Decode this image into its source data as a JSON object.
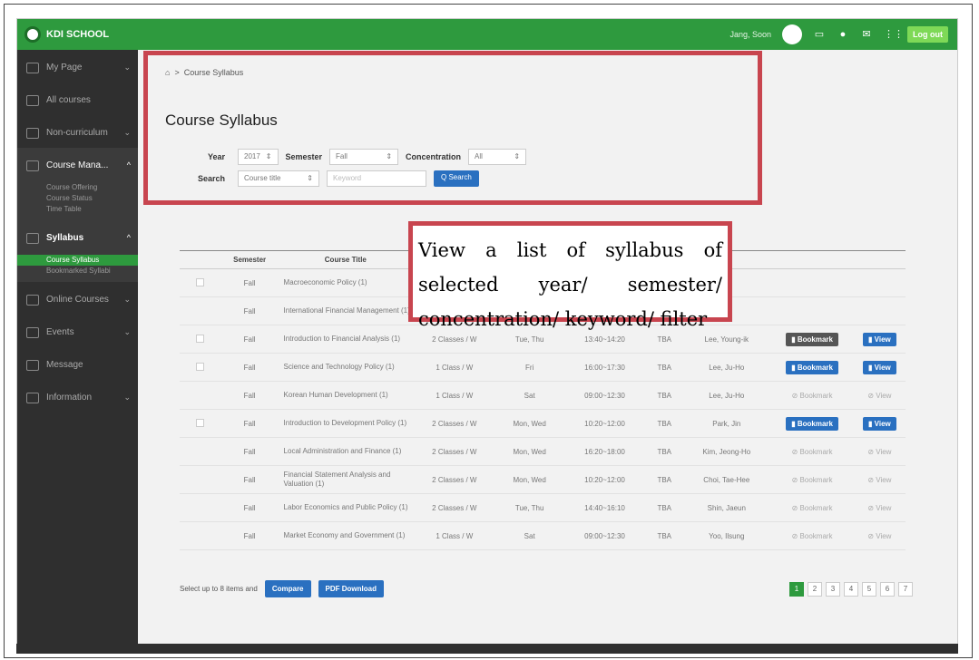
{
  "topbar": {
    "logo_text": "KDI SCHOOL",
    "user_name": "Jang, Soon",
    "logout_label": "Log out",
    "icons": [
      "monitor-icon",
      "bell-icon",
      "mail-icon",
      "grid-icon"
    ]
  },
  "sidebar": {
    "items": [
      {
        "label": "My Page",
        "chevron": "⌄"
      },
      {
        "label": "All courses",
        "chevron": ""
      },
      {
        "label": "Non-curriculum",
        "chevron": "⌄"
      },
      {
        "label": "Course Mana...",
        "chevron": "^"
      },
      {
        "label": "Syllabus",
        "chevron": "^"
      },
      {
        "label": "Online Courses",
        "chevron": "⌄"
      },
      {
        "label": "Events",
        "chevron": "⌄"
      },
      {
        "label": "Message",
        "chevron": ""
      },
      {
        "label": "Information",
        "chevron": "⌄"
      }
    ],
    "course_sub": [
      "Course Offering",
      "Course Status",
      "Time Table"
    ],
    "syllabus_sub": [
      "Course Syllabus",
      "Bookmarked Syllabi"
    ]
  },
  "breadcrumb": {
    "home_icon": "⌂",
    "sep": ">",
    "current": "Course Syllabus"
  },
  "page_title": "Course Syllabus",
  "filters": {
    "year_label": "Year",
    "year_value": "2017",
    "semester_label": "Semester",
    "semester_value": "Fall",
    "concentration_label": "Concentration",
    "concentration_value": "All",
    "search_label": "Search",
    "search_field": "Course title",
    "keyword_placeholder": "Keyword",
    "search_button": "Q Search"
  },
  "callout": "View a list of syllabus of selected year/ semester/ concentration/ keyword/ filter",
  "table": {
    "headers": [
      "",
      "Semester",
      "Course Title",
      "",
      "",
      "",
      "",
      "",
      "",
      ""
    ],
    "rows": [
      {
        "semester": "Fall",
        "title": "Macroeconomic Policy (1)",
        "credit": "",
        "days": "",
        "time": "",
        "room": "",
        "prof": "",
        "bm": "none",
        "view": "none"
      },
      {
        "semester": "Fall",
        "title": "International Financial Management (1)",
        "credit": "",
        "days": "",
        "time": "",
        "room": "",
        "prof": "",
        "bm": "none",
        "view": "none"
      },
      {
        "semester": "Fall",
        "title": "Introduction to Financial Analysis (1)",
        "credit": "2 Classes / W",
        "days": "Tue, Thu",
        "time": "13:40~14:20",
        "room": "TBA",
        "prof": "Lee, Young-ik",
        "bm": "Bookmark",
        "view": "View"
      },
      {
        "semester": "Fall",
        "title": "Science and Technology Policy (1)",
        "credit": "1 Class / W",
        "days": "Fri",
        "time": "16:00~17:30",
        "room": "TBA",
        "prof": "Lee, Ju-Ho",
        "bm": "Bookmark",
        "view": "View"
      },
      {
        "semester": "Fall",
        "title": "Korean Human Development (1)",
        "credit": "1 Class / W",
        "days": "Sat",
        "time": "09:00~12:30",
        "room": "TBA",
        "prof": "Lee, Ju-Ho",
        "bm": "Bookmark",
        "view": "View"
      },
      {
        "semester": "Fall",
        "title": "Introduction to Development Policy (1)",
        "credit": "2 Classes / W",
        "days": "Mon, Wed",
        "time": "10:20~12:00",
        "room": "TBA",
        "prof": "Park, Jin",
        "bm": "Bookmark",
        "view": "View"
      },
      {
        "semester": "Fall",
        "title": "Local Administration and Finance (1)",
        "credit": "2 Classes / W",
        "days": "Mon, Wed",
        "time": "16:20~18:00",
        "room": "TBA",
        "prof": "Kim, Jeong-Ho",
        "bm": "Bookmark",
        "view": "View"
      },
      {
        "semester": "Fall",
        "title": "Financial Statement Analysis and Valuation (1)",
        "credit": "2 Classes / W",
        "days": "Mon, Wed",
        "time": "10:20~12:00",
        "room": "TBA",
        "prof": "Choi, Tae-Hee",
        "bm": "Bookmark",
        "view": "View"
      },
      {
        "semester": "Fall",
        "title": "Labor Economics and Public Policy (1)",
        "credit": "2 Classes / W",
        "days": "Tue, Thu",
        "time": "14:40~16:10",
        "room": "TBA",
        "prof": "Shin, Jaeun",
        "bm": "Bookmark",
        "view": "View"
      },
      {
        "semester": "Fall",
        "title": "Market Economy and Government (1)",
        "credit": "1 Class / W",
        "days": "Sat",
        "time": "09:00~12:30",
        "room": "TBA",
        "prof": "Yoo, Ilsung",
        "bm": "Bookmark",
        "view": "View"
      }
    ]
  },
  "bottom": {
    "select_text": "Select up to 8 items and",
    "compare_label": "Compare",
    "pdf_label": "PDF Download",
    "pages": [
      "1",
      "2",
      "3",
      "4",
      "5",
      "6",
      "7"
    ]
  }
}
